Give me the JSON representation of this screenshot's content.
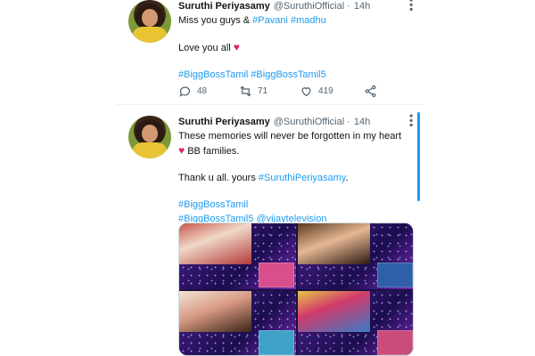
{
  "tweets": [
    {
      "name": "Suruthi Periyasamy",
      "handle": "@SuruthiOfficial",
      "separator": "·",
      "time": "14h",
      "line1_prefix": "Miss you guys & ",
      "line1_tag1": "#Pavani",
      "line1_tag2": "#madhu",
      "line2": "Love you all",
      "hashtags": "#BiggBossTamil #BiggBossTamil5",
      "replies": "48",
      "retweets": "71",
      "likes": "419"
    },
    {
      "name": "Suruthi Periyasamy",
      "handle": "@SuruthiOfficial",
      "separator": "·",
      "time": "14h",
      "line1": "These memories will never be forgotten in my heart",
      "line2": "BB families.",
      "line3_prefix": "Thank u all. yours ",
      "line3_tag": "#SuruthiPeriyasamy",
      "line3_suffix": ".",
      "tag_a": "#BiggBossTamil",
      "tag_b": "#BiggBossTamil5",
      "tag_c": "@vijaytelevision"
    }
  ],
  "icons": {
    "reply": "reply-icon",
    "retweet": "retweet-icon",
    "like": "heart-icon",
    "share": "share-icon",
    "more": "more-icon",
    "heart_emoji": "red-heart-emoji"
  },
  "colors": {
    "link": "#1d9bf0",
    "heart": "#e0245e",
    "muted": "#536471"
  },
  "media": {
    "tiles": 4
  }
}
